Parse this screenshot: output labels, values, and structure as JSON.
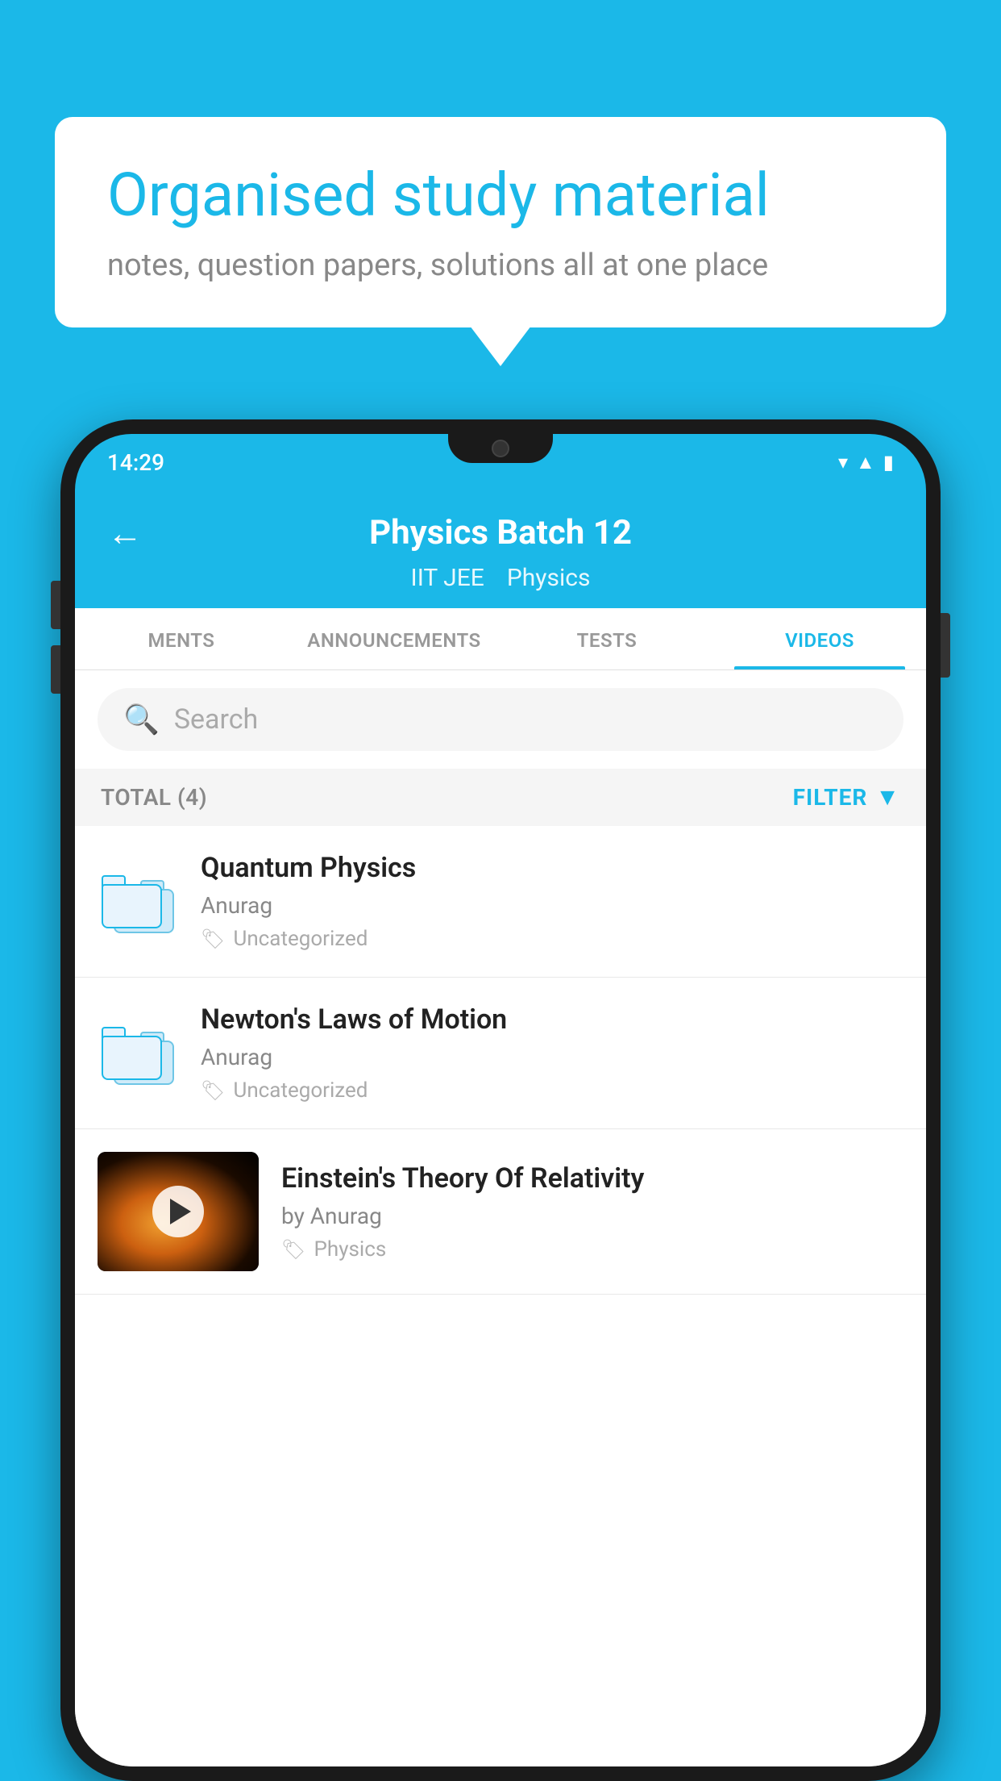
{
  "background_color": "#1bb8e8",
  "speech_bubble": {
    "heading": "Organised study material",
    "subtext": "notes, question papers, solutions all at one place"
  },
  "phone": {
    "status_time": "14:29",
    "header": {
      "title": "Physics Batch 12",
      "subtitle_left": "IIT JEE",
      "subtitle_right": "Physics",
      "back_label": "←"
    },
    "tabs": [
      {
        "label": "MENTS",
        "active": false
      },
      {
        "label": "ANNOUNCEMENTS",
        "active": false
      },
      {
        "label": "TESTS",
        "active": false
      },
      {
        "label": "VIDEOS",
        "active": true
      }
    ],
    "search": {
      "placeholder": "Search"
    },
    "filter_bar": {
      "total_label": "TOTAL (4)",
      "filter_label": "FILTER"
    },
    "list_items": [
      {
        "title": "Quantum Physics",
        "author": "Anurag",
        "tag": "Uncategorized",
        "type": "folder"
      },
      {
        "title": "Newton's Laws of Motion",
        "author": "Anurag",
        "tag": "Uncategorized",
        "type": "folder"
      },
      {
        "title": "Einstein's Theory Of Relativity",
        "author": "by Anurag",
        "tag": "Physics",
        "type": "video"
      }
    ]
  }
}
